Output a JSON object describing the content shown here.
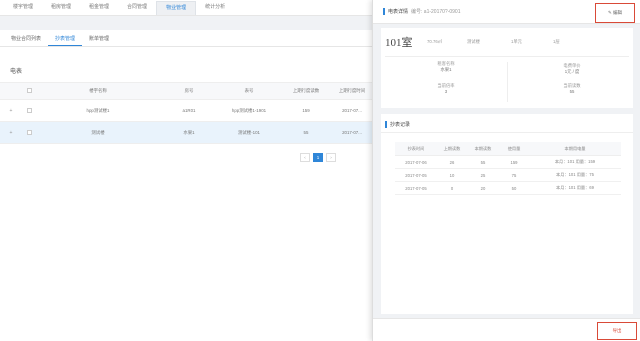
{
  "nav": [
    "楼宇管理",
    "租房管理",
    "租金管理",
    "合同管理",
    "物业管理",
    "统计分析"
  ],
  "subtabs": [
    "物业合同列表",
    "抄表管理",
    "账单管理"
  ],
  "section_title": "电表",
  "table": {
    "headers": [
      "",
      "",
      "楼宇名称",
      "房号",
      "表号",
      "上期行度读数",
      "上期行度时间"
    ],
    "rows": [
      {
        "expand": "+",
        "building": "hpp测试楼1",
        "room": "a1R01",
        "meter": "hpp测试楼1-1901",
        "reading": "159",
        "time": "2017-07..."
      },
      {
        "expand": "+",
        "building": "测试楼",
        "room": "水果1",
        "meter": "测试楼-101",
        "reading": "55",
        "time": "2017-07..."
      }
    ]
  },
  "pager": {
    "prev": "‹",
    "current": "1",
    "next": "›"
  },
  "drawer": {
    "title": "电表详情",
    "subtitle": "编号: a1-20170?-0901",
    "edit_label": "编辑",
    "room": "101室",
    "area": "70.76㎡",
    "building": "测试楼",
    "unit": "1单元",
    "floor": "1层",
    "info": [
      {
        "label": "租客名称",
        "value": "水果1"
      },
      {
        "label": "电费单价",
        "value": "1元 / 度"
      },
      {
        "label": "当前倍率",
        "value": "3"
      },
      {
        "label": "当前读数",
        "value": "55"
      }
    ],
    "records_title": "抄表记录",
    "records_headers": [
      "抄表时间",
      "上期读数",
      "本期读数",
      "使用量",
      "本期用电量"
    ],
    "records": [
      {
        "date": "2017-07-06",
        "prev": "26",
        "curr": "55",
        "used": "159",
        "note": "本月：101 用量：159"
      },
      {
        "date": "2017-07-05",
        "prev": "10",
        "curr": "25",
        "used": "75",
        "note": "本月：101 用量：75"
      },
      {
        "date": "2017-07-05",
        "prev": "0",
        "curr": "20",
        "used": "50",
        "note": "本月：101 用量：69"
      }
    ],
    "records_page": "1",
    "export_label": "导出"
  }
}
